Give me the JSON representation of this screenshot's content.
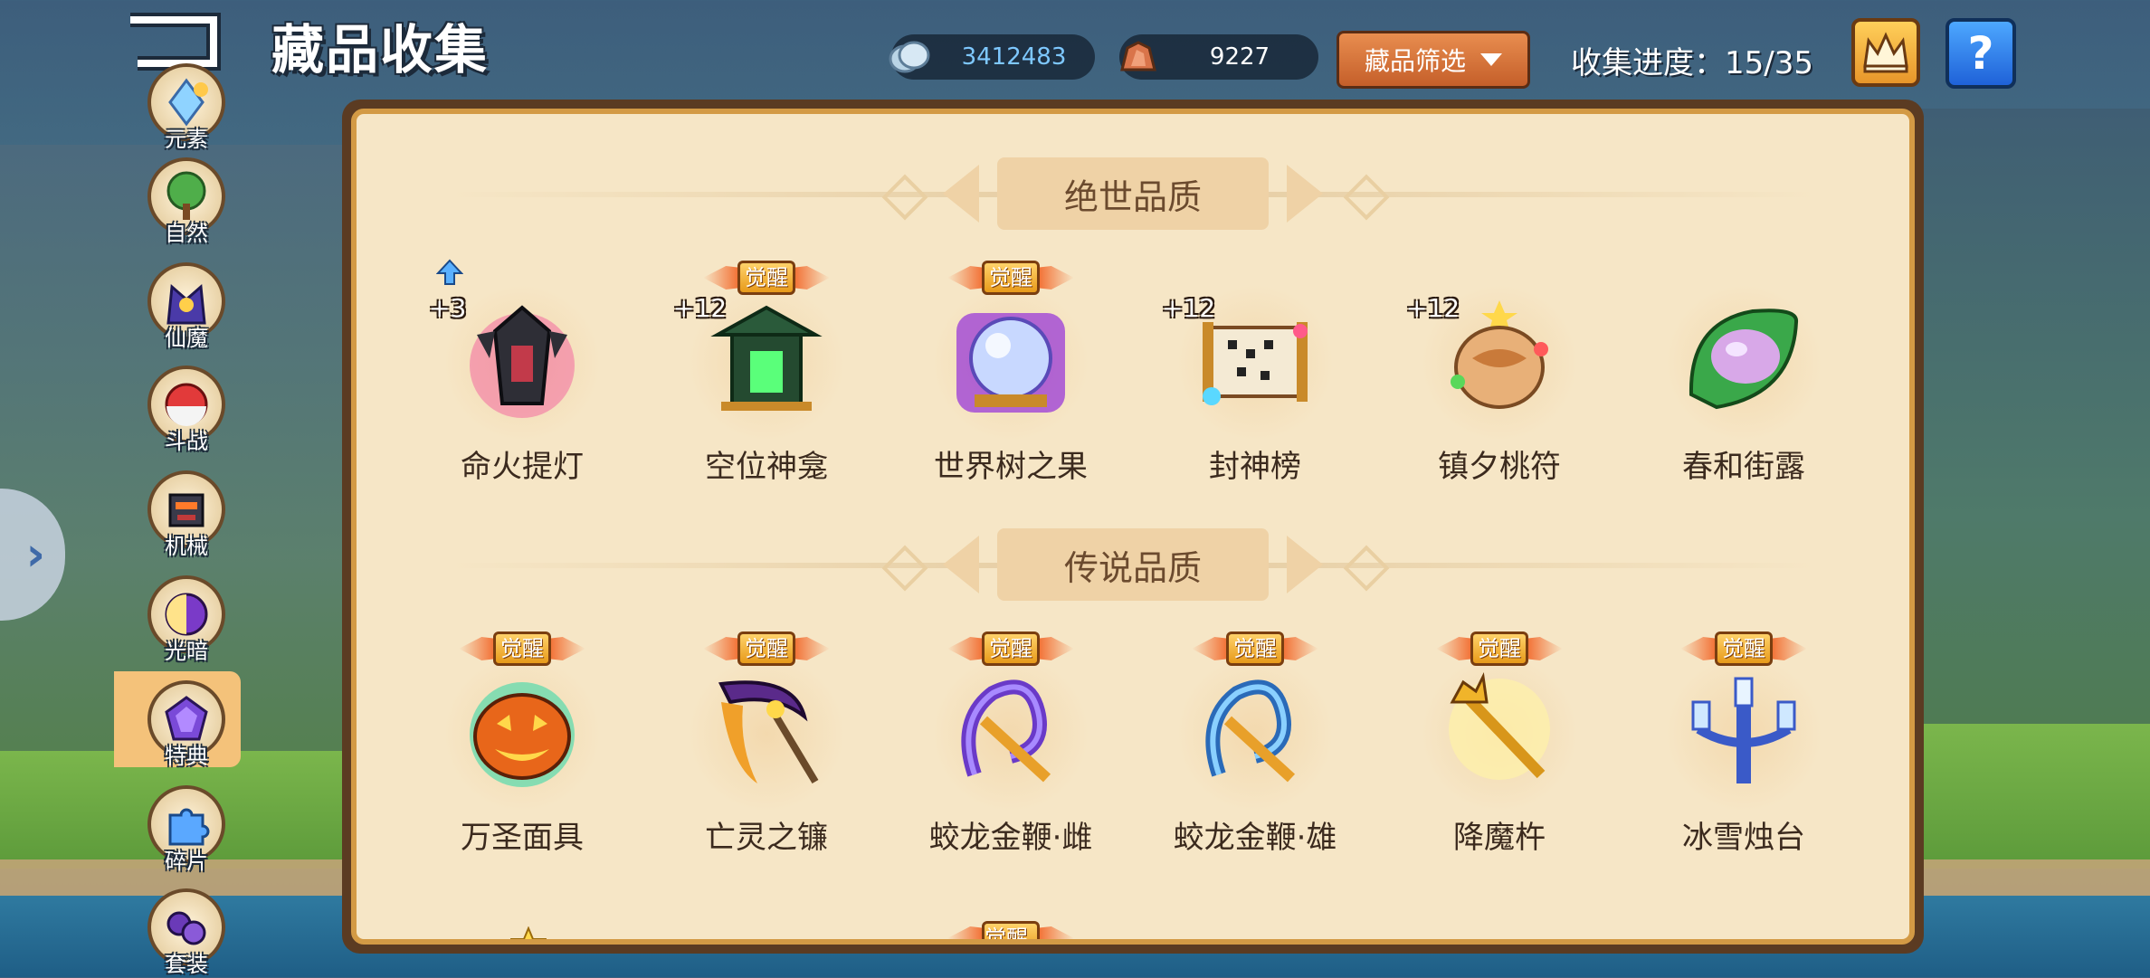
{
  "header": {
    "title": "藏品收集",
    "currencies": [
      {
        "icon": "silver-coin-icon",
        "value": "3412483"
      },
      {
        "icon": "ore-crystal-icon",
        "value": "9227"
      }
    ],
    "filter_label": "藏品筛选",
    "progress_label": "收集进度：15/35"
  },
  "sidebar": {
    "active": "特典",
    "items": [
      {
        "label": "元素",
        "icon": "element-crystal-icon"
      },
      {
        "label": "自然",
        "icon": "tree-icon"
      },
      {
        "label": "仙魔",
        "icon": "demon-icon"
      },
      {
        "label": "斗战",
        "icon": "battle-orb-icon"
      },
      {
        "label": "机械",
        "icon": "robot-icon"
      },
      {
        "label": "光暗",
        "icon": "light-dark-icon"
      },
      {
        "label": "特典",
        "icon": "special-crystal-icon"
      },
      {
        "label": "碎片",
        "icon": "puzzle-piece-icon"
      },
      {
        "label": "套装",
        "icon": "purple-gem-icon"
      }
    ]
  },
  "sections": [
    {
      "title": "绝世品质",
      "items": [
        {
          "name": "命火提灯",
          "plus": "+3",
          "awakened": false,
          "upgrade_arrow": true,
          "icon": "lantern-icon"
        },
        {
          "name": "空位神龛",
          "plus": "+12",
          "awakened": true,
          "icon": "shrine-icon"
        },
        {
          "name": "世界树之果",
          "plus": "",
          "awakened": true,
          "icon": "crystal-fruit-icon"
        },
        {
          "name": "封神榜",
          "plus": "+12",
          "awakened": false,
          "icon": "scroll-icon"
        },
        {
          "name": "镇夕桃符",
          "plus": "+12",
          "awakened": false,
          "icon": "talisman-icon"
        },
        {
          "name": "春和街露",
          "plus": "",
          "awakened": false,
          "icon": "dew-leaf-icon"
        }
      ]
    },
    {
      "title": "传说品质",
      "items": [
        {
          "name": "万圣面具",
          "plus": "",
          "awakened": true,
          "icon": "pumpkin-mask-icon"
        },
        {
          "name": "亡灵之镰",
          "plus": "",
          "awakened": true,
          "icon": "scythe-icon"
        },
        {
          "name": "蛟龙金鞭·雌",
          "plus": "",
          "awakened": true,
          "icon": "dragon-whip-purple-icon"
        },
        {
          "name": "蛟龙金鞭·雄",
          "plus": "",
          "awakened": true,
          "icon": "dragon-whip-blue-icon"
        },
        {
          "name": "降魔杵",
          "plus": "",
          "awakened": true,
          "icon": "vajra-icon"
        },
        {
          "name": "冰雪烛台",
          "plus": "",
          "awakened": true,
          "icon": "ice-candelabra-icon"
        }
      ]
    }
  ],
  "awaken_badge_label": "觉醒",
  "colors": {
    "panel_bg": "#f6e6c6",
    "panel_border": "#d39a45",
    "filter_button": "#d9743a",
    "help_button": "#2f7fe8",
    "silver_value": "#7ec8ff"
  }
}
